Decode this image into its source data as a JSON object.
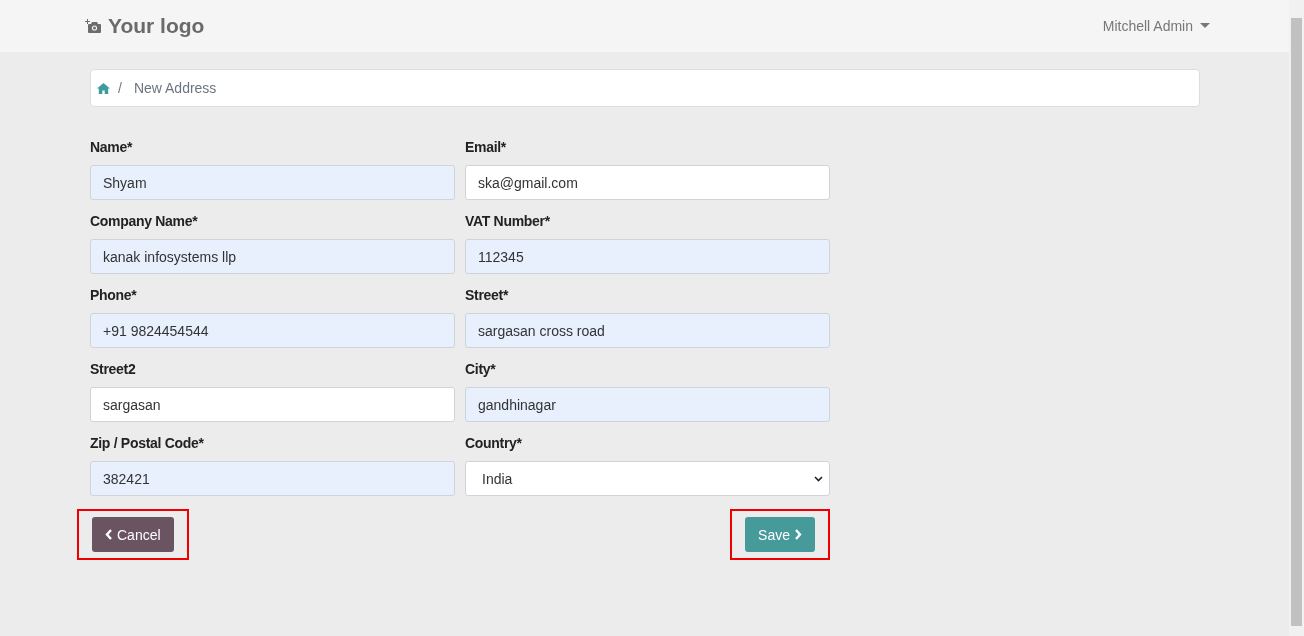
{
  "header": {
    "logo": "Your logo",
    "user": "Mitchell Admin"
  },
  "breadcrumb": {
    "separator": "/",
    "current": "New Address"
  },
  "fields": [
    {
      "kind": "input",
      "label": "Name*",
      "value": "Shyam",
      "autofilled": true
    },
    {
      "kind": "input",
      "label": "Email*",
      "value": "ska@gmail.com",
      "autofilled": false
    },
    {
      "kind": "input",
      "label": "Company Name*",
      "value": "kanak infosystems llp",
      "autofilled": true
    },
    {
      "kind": "input",
      "label": "VAT Number*",
      "value": "112345",
      "autofilled": true
    },
    {
      "kind": "input",
      "label": "Phone*",
      "value": "+91 9824454544",
      "autofilled": true
    },
    {
      "kind": "input",
      "label": "Street*",
      "value": "sargasan cross road",
      "autofilled": true
    },
    {
      "kind": "input",
      "label": "Street2",
      "value": "sargasan",
      "autofilled": false
    },
    {
      "kind": "input",
      "label": "City*",
      "value": "gandhinagar",
      "autofilled": true
    },
    {
      "kind": "input",
      "label": "Zip / Postal Code*",
      "value": "382421",
      "autofilled": true
    },
    {
      "kind": "select",
      "label": "Country*",
      "value": "India",
      "autofilled": false
    }
  ],
  "buttons": [
    {
      "kind": "back",
      "label": "Cancel",
      "highlighted": true
    },
    {
      "kind": "forward",
      "label": "Save",
      "highlighted": true
    }
  ]
}
